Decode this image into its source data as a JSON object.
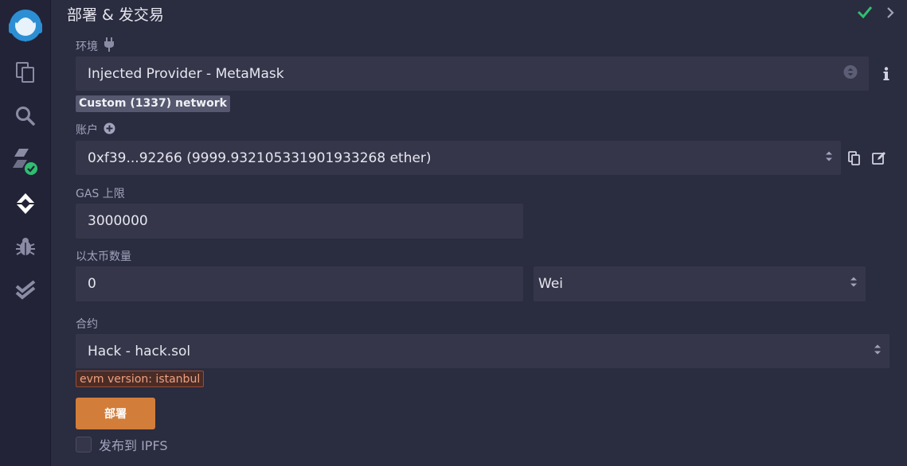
{
  "header": {
    "title": "部署 & 发交易"
  },
  "environment": {
    "label": "环境",
    "value": "Injected Provider - MetaMask",
    "network_badge": "Custom (1337) network"
  },
  "account": {
    "label": "账户",
    "value": "0xf39...92266 (9999.932105331901933268 ether)"
  },
  "gas": {
    "label": "GAS 上限",
    "value": "3000000"
  },
  "ether": {
    "label": "以太币数量",
    "value": "0",
    "unit": "Wei"
  },
  "contract": {
    "label": "合约",
    "value": "Hack - hack.sol",
    "evm_badge": "evm version: istanbul"
  },
  "deploy_button": "部署",
  "publish_ipfs": {
    "label": "发布到 IPFS",
    "checked": false
  },
  "colors": {
    "accent": "#d27d3a",
    "success": "#2fbf71",
    "bg": "#2a2c3f",
    "rail": "#222336",
    "field": "#353649"
  },
  "sidebar_icons": [
    "remix-logo-icon",
    "file-explorer-icon",
    "search-icon",
    "solidity-compiler-icon",
    "deploy-run-icon",
    "debugger-icon",
    "test-check-icon"
  ]
}
